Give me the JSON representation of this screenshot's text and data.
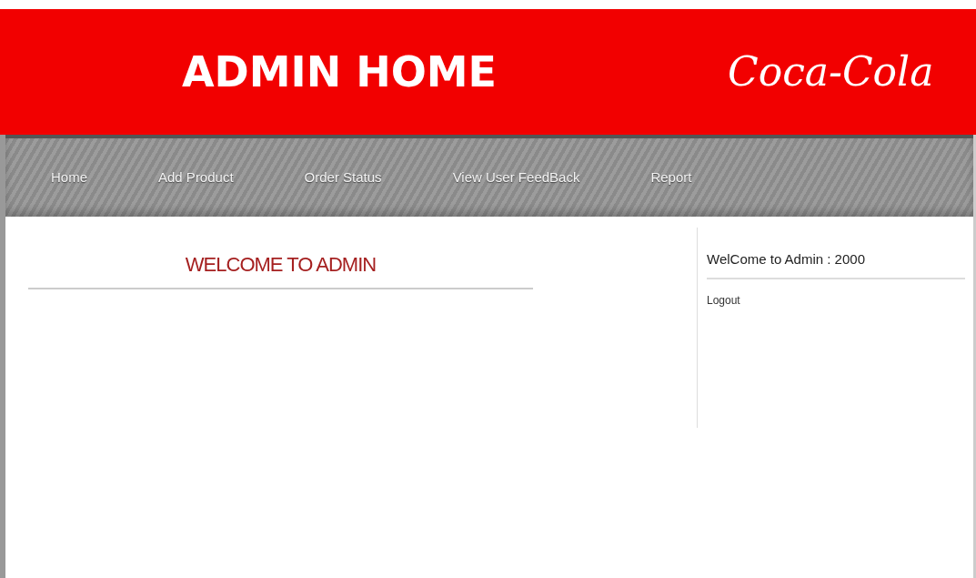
{
  "header": {
    "title": "ADMIN HOME",
    "logo_text": "Coca-Cola"
  },
  "nav": [
    {
      "label": "Home"
    },
    {
      "label": "Add Product"
    },
    {
      "label": "Order Status"
    },
    {
      "label": "View User FeedBack"
    },
    {
      "label": "Report"
    }
  ],
  "main": {
    "heading": "WELCOME TO ADMIN"
  },
  "sidebar": {
    "greeting": "WelCome to Admin : 2000",
    "links": [
      "Logout"
    ]
  }
}
